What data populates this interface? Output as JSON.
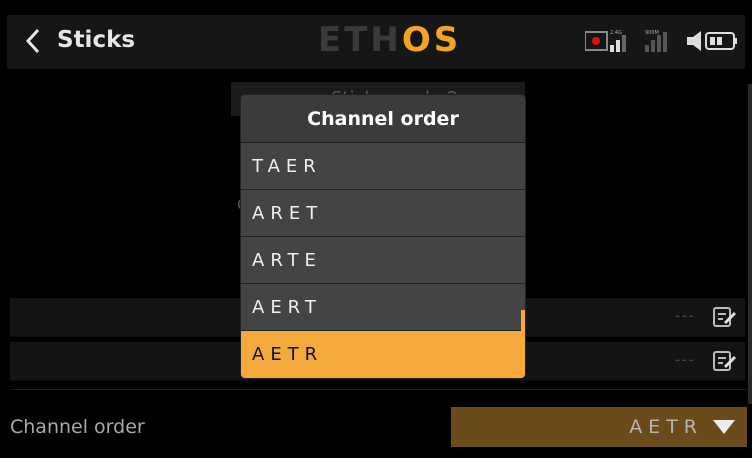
{
  "header": {
    "title": "Sticks",
    "logo_main": "ETH",
    "logo_accent": "OS",
    "status": {
      "band": "2.4G",
      "power": "900M"
    }
  },
  "background": {
    "mode_text": "Sticks mode 2",
    "rows": [
      {
        "value": "---"
      },
      {
        "value": "---"
      }
    ],
    "channel_order_label": "Channel order",
    "channel_order_value": "AETR",
    "obscured_char": "C"
  },
  "modal": {
    "title": "Channel order",
    "options": [
      "TAER",
      "ARET",
      "ARTE",
      "AERT",
      "AETR"
    ],
    "selected_index": 4
  },
  "colors": {
    "accent": "#f3a93b",
    "logo_accent": "#f3a51f",
    "select_bg": "#6b4a1c",
    "modal_bg": "#444444"
  },
  "icons": [
    "back-arrow-icon",
    "record-icon",
    "signal-icon",
    "speaker-icon",
    "battery-icon",
    "edit-icon",
    "dropdown-arrow-icon"
  ]
}
